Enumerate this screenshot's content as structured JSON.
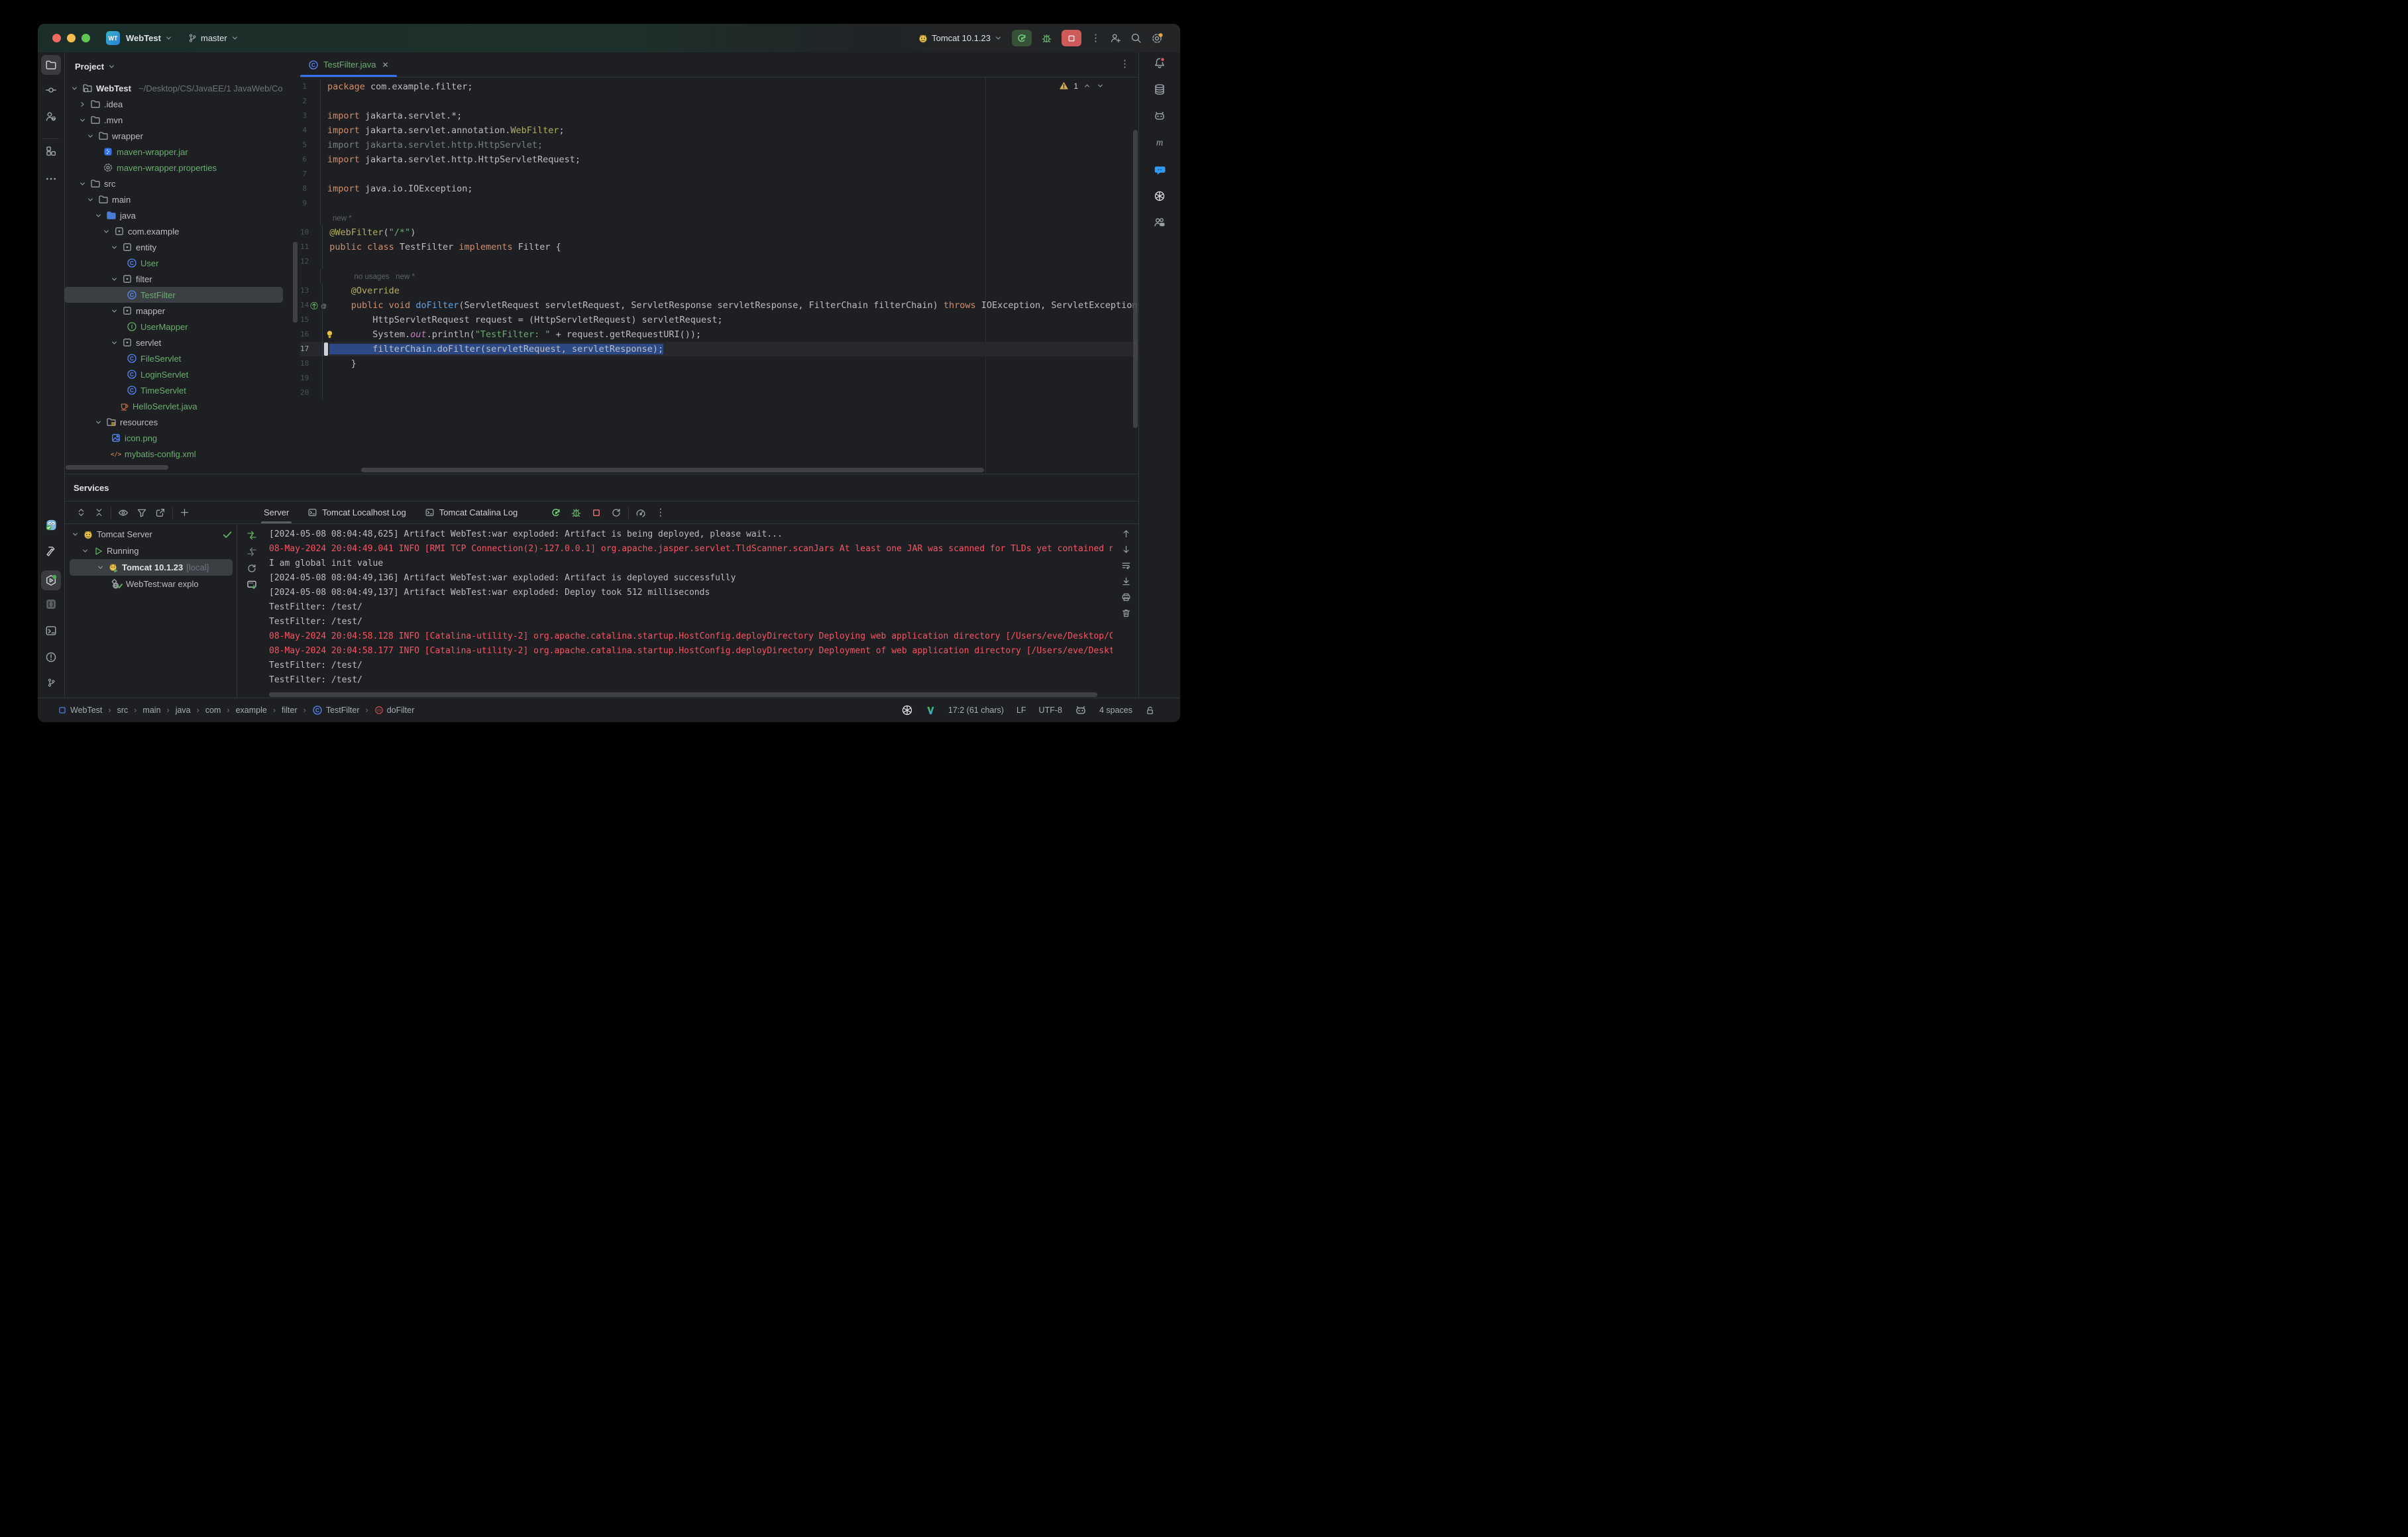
{
  "titlebar": {
    "logo": "WT",
    "project": "WebTest",
    "branch": "master",
    "run_config": "Tomcat 10.1.23"
  },
  "project_panel": {
    "header": "Project",
    "items": [
      {
        "lvl": 0,
        "chev": "v",
        "icon": "module-folder",
        "label": "WebTest",
        "path": "~/Desktop/CS/JavaEE/1 JavaWeb/Co",
        "bold": true
      },
      {
        "lvl": 1,
        "chev": ">",
        "icon": "folder",
        "label": ".idea"
      },
      {
        "lvl": 1,
        "chev": "v",
        "icon": "folder",
        "label": ".mvn"
      },
      {
        "lvl": 2,
        "chev": "v",
        "icon": "folder",
        "label": "wrapper"
      },
      {
        "lvl": 3,
        "chev": "",
        "icon": "jar",
        "label": "maven-wrapper.jar",
        "green": true
      },
      {
        "lvl": 3,
        "chev": "",
        "icon": "gear-file",
        "label": "maven-wrapper.properties",
        "green": true
      },
      {
        "lvl": 1,
        "chev": "v",
        "icon": "folder",
        "label": "src"
      },
      {
        "lvl": 2,
        "chev": "v",
        "icon": "folder",
        "label": "main"
      },
      {
        "lvl": 3,
        "chev": "v",
        "icon": "folder-blue",
        "label": "java"
      },
      {
        "lvl": 4,
        "chev": "v",
        "icon": "package",
        "label": "com.example"
      },
      {
        "lvl": 5,
        "chev": "v",
        "icon": "package",
        "label": "entity"
      },
      {
        "lvl": 6,
        "chev": "",
        "icon": "class",
        "label": "User",
        "green": true
      },
      {
        "lvl": 5,
        "chev": "v",
        "icon": "package",
        "label": "filter"
      },
      {
        "lvl": 6,
        "chev": "",
        "icon": "class",
        "label": "TestFilter",
        "green": true,
        "sel": true
      },
      {
        "lvl": 5,
        "chev": "v",
        "icon": "package",
        "label": "mapper"
      },
      {
        "lvl": 6,
        "chev": "",
        "icon": "interface",
        "label": "UserMapper",
        "green": true
      },
      {
        "lvl": 5,
        "chev": "v",
        "icon": "package",
        "label": "servlet"
      },
      {
        "lvl": 6,
        "chev": "",
        "icon": "class",
        "label": "FileServlet",
        "green": true
      },
      {
        "lvl": 6,
        "chev": "",
        "icon": "class",
        "label": "LoginServlet",
        "green": true
      },
      {
        "lvl": 6,
        "chev": "",
        "icon": "class",
        "label": "TimeServlet",
        "green": true
      },
      {
        "lvl": 5,
        "chev": "",
        "icon": "java-file",
        "label": "HelloServlet.java",
        "green": true
      },
      {
        "lvl": 3,
        "chev": "v",
        "icon": "folder-resources",
        "label": "resources"
      },
      {
        "lvl": 4,
        "chev": "",
        "icon": "image-file",
        "label": "icon.png",
        "green": true
      },
      {
        "lvl": 4,
        "chev": "",
        "icon": "xml-file",
        "label": "mybatis-config.xml",
        "green": true
      }
    ]
  },
  "editor": {
    "tab": {
      "label": "TestFilter.java",
      "icon": "class"
    },
    "warning_count": "1",
    "lines": [
      {
        "n": "1",
        "segs": [
          [
            "package",
            "k"
          ],
          [
            " com.example.filter;",
            "p"
          ]
        ]
      },
      {
        "n": "2",
        "segs": []
      },
      {
        "n": "3",
        "segs": [
          [
            "import",
            "k"
          ],
          [
            " jakarta.servlet.*;",
            "p"
          ]
        ]
      },
      {
        "n": "4",
        "segs": [
          [
            "import",
            "k"
          ],
          [
            " jakarta.servlet.annotation.",
            "p"
          ],
          [
            "WebFilter",
            "a"
          ],
          [
            ";",
            "p"
          ]
        ]
      },
      {
        "n": "5",
        "segs": [
          [
            "import jakarta.servlet.http.HttpServlet;",
            "g"
          ]
        ]
      },
      {
        "n": "6",
        "segs": [
          [
            "import",
            "k"
          ],
          [
            " jakarta.servlet.http.HttpServletRequest;",
            "p"
          ]
        ]
      },
      {
        "n": "7",
        "segs": []
      },
      {
        "n": "8",
        "segs": [
          [
            "import",
            "k"
          ],
          [
            " java.io.IOException;",
            "p"
          ]
        ]
      },
      {
        "n": "9",
        "segs": []
      },
      {
        "inlay": "new *",
        "ind": 0
      },
      {
        "n": "10",
        "segs": [
          [
            "@WebFilter",
            "a"
          ],
          [
            "(",
            "p"
          ],
          [
            "\"/*\"",
            "s"
          ],
          [
            ")",
            "p"
          ]
        ]
      },
      {
        "n": "11",
        "segs": [
          [
            "public class ",
            "k"
          ],
          [
            "TestFilter ",
            "p"
          ],
          [
            "implements",
            "k"
          ],
          [
            " Filter {",
            "p"
          ]
        ]
      },
      {
        "n": "12",
        "segs": []
      },
      {
        "inlay": "no usages   new *",
        "ind": 4
      },
      {
        "n": "13",
        "segs": [
          [
            "    ",
            "p"
          ],
          [
            "@Override",
            "a"
          ]
        ]
      },
      {
        "n": "14",
        "gutter": [
          "implements-icon",
          "annotation-gutter-icon"
        ],
        "segs": [
          [
            "    ",
            "p"
          ],
          [
            "public void ",
            "k"
          ],
          [
            "doFilter",
            "m"
          ],
          [
            "(ServletRequest servletRequest, ServletResponse servletResponse, FilterChain filterChain) ",
            "p"
          ],
          [
            "throws",
            "k"
          ],
          [
            " IOException, ServletException {",
            "p"
          ]
        ]
      },
      {
        "n": "15",
        "segs": [
          [
            "        HttpServletRequest request = (HttpServletRequest) servletRequest;",
            "p"
          ]
        ]
      },
      {
        "n": "16",
        "bulb": true,
        "segs": [
          [
            "        System.",
            "p"
          ],
          [
            "out",
            "f"
          ],
          [
            ".println(",
            "p"
          ],
          [
            "\"TestFilter: \"",
            "s"
          ],
          [
            " + request.getRequestURI());",
            "p"
          ]
        ]
      },
      {
        "n": "17",
        "sel": true,
        "segs": [
          [
            "        filterChain.doFilter(servletRequest, servletResponse);",
            "p"
          ]
        ]
      },
      {
        "n": "18",
        "segs": [
          [
            "    }",
            "p"
          ]
        ]
      },
      {
        "n": "19",
        "segs": []
      },
      {
        "n": "20",
        "segs": []
      }
    ]
  },
  "services": {
    "title": "Services",
    "tabs": [
      {
        "label": "Server",
        "active": true
      },
      {
        "label": "Tomcat Localhost Log",
        "icon": "console"
      },
      {
        "label": "Tomcat Catalina Log",
        "icon": "console"
      }
    ],
    "tree": [
      {
        "lvl": 0,
        "chev": "v",
        "icon": "tomcat",
        "label": "Tomcat Server",
        "status": "check"
      },
      {
        "lvl": 1,
        "chev": "v",
        "icon": "run-outline",
        "label": "Running"
      },
      {
        "lvl": 2,
        "chev": "v",
        "icon": "tomcat-run",
        "label": "Tomcat 10.1.23",
        "suffix": "[local]",
        "sel": true,
        "bold": true
      },
      {
        "lvl": 3,
        "chev": "",
        "icon": "artifact-check",
        "label": "WebTest:war explo"
      }
    ],
    "console": [
      {
        "cls": "p",
        "text": "[2024-05-08 08:04:48,625] Artifact WebTest:war exploded: Artifact is being deployed, please wait..."
      },
      {
        "cls": "r",
        "text": "08-May-2024 20:04:49.041 INFO [RMI TCP Connection(2)-127.0.0.1] org.apache.jasper.servlet.TldScanner.scanJars At least one JAR was scanned for TLDs yet contained n"
      },
      {
        "cls": "p",
        "text": "I am global init value"
      },
      {
        "cls": "p",
        "text": "[2024-05-08 08:04:49,136] Artifact WebTest:war exploded: Artifact is deployed successfully"
      },
      {
        "cls": "p",
        "text": "[2024-05-08 08:04:49,137] Artifact WebTest:war exploded: Deploy took 512 milliseconds"
      },
      {
        "cls": "p",
        "text": "TestFilter: /test/"
      },
      {
        "cls": "p",
        "text": "TestFilter: /test/"
      },
      {
        "cls": "r",
        "text": "08-May-2024 20:04:58.128 INFO [Catalina-utility-2] org.apache.catalina.startup.HostConfig.deployDirectory Deploying web application directory [/Users/eve/Desktop/C"
      },
      {
        "cls": "r",
        "text": "08-May-2024 20:04:58.177 INFO [Catalina-utility-2] org.apache.catalina.startup.HostConfig.deployDirectory Deployment of web application directory [/Users/eve/Deskt"
      },
      {
        "cls": "p",
        "text": "TestFilter: /test/"
      },
      {
        "cls": "p",
        "text": "TestFilter: /test/"
      }
    ]
  },
  "statusbar": {
    "breadcrumbs": [
      {
        "icon": "module",
        "label": "WebTest"
      },
      {
        "label": "src"
      },
      {
        "label": "main"
      },
      {
        "label": "java"
      },
      {
        "label": "com"
      },
      {
        "label": "example"
      },
      {
        "label": "filter"
      },
      {
        "icon": "class",
        "label": "TestFilter"
      },
      {
        "icon": "method",
        "label": "doFilter"
      }
    ],
    "position": "17:2 (61 chars)",
    "line_ending": "LF",
    "encoding": "UTF-8",
    "indent": "4 spaces"
  },
  "colors": {
    "accent": "#3574F0",
    "error_red": "#F75464",
    "added_green": "#6BAE70",
    "warning": "#D6AE58",
    "selection": "#2B4A85",
    "titlebar_green": "#1D302B"
  }
}
